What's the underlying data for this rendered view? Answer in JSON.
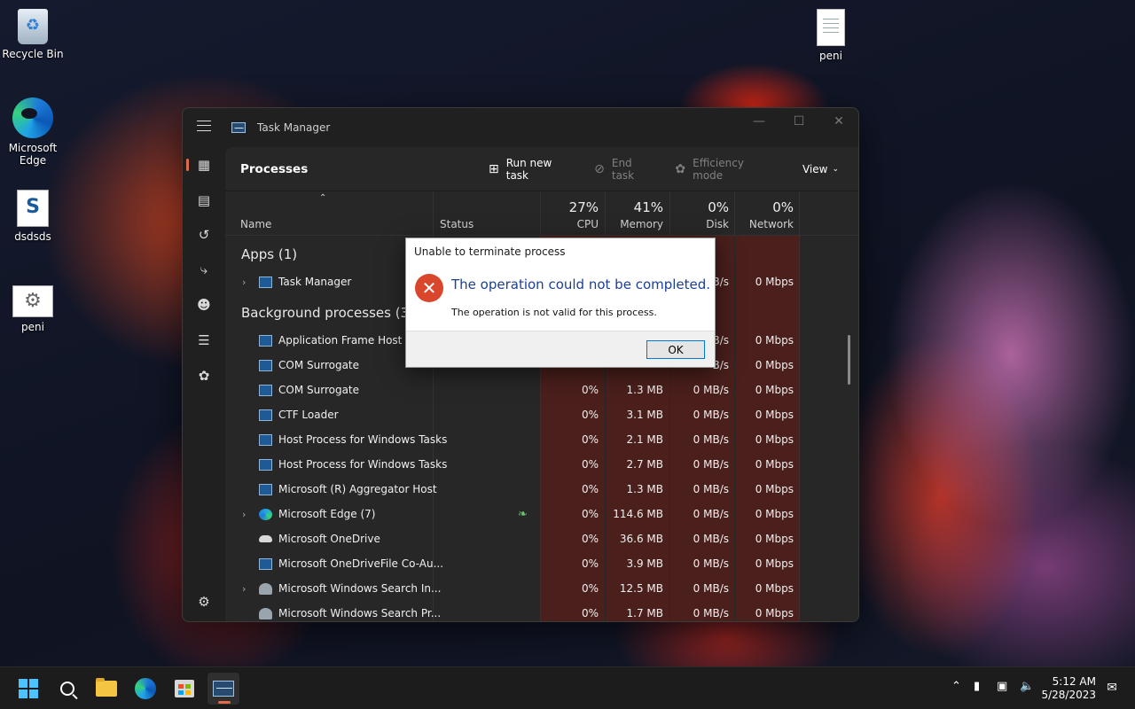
{
  "desktop": {
    "icons": [
      {
        "label": "Recycle Bin"
      },
      {
        "label": "Microsoft Edge"
      },
      {
        "label": "dsdsds"
      },
      {
        "label": "peni"
      },
      {
        "label": "peni"
      }
    ]
  },
  "task_manager": {
    "title": "Task Manager",
    "page_title": "Processes",
    "commands": {
      "run_new_task": "Run new task",
      "end_task": "End task",
      "efficiency_mode": "Efficiency mode",
      "view": "View"
    },
    "columns": {
      "name": "Name",
      "status": "Status",
      "cpu": {
        "label": "CPU",
        "percent": "27%"
      },
      "memory": {
        "label": "Memory",
        "percent": "41%"
      },
      "disk": {
        "label": "Disk",
        "percent": "0%"
      },
      "network": {
        "label": "Network",
        "percent": "0%"
      }
    },
    "groups": {
      "apps": "Apps (1)",
      "background": "Background processes (30)"
    },
    "app_rows": [
      {
        "name": "Task Manager",
        "cpu": "",
        "memory": "",
        "disk": "B/s",
        "network": "0 Mbps"
      }
    ],
    "background_rows": [
      {
        "name": "Application Frame Host",
        "cpu": "",
        "memory": "",
        "disk": "B/s",
        "network": "0 Mbps"
      },
      {
        "name": "COM Surrogate",
        "cpu": "",
        "memory": "",
        "disk": "B/s",
        "network": "0 Mbps"
      },
      {
        "name": "COM Surrogate",
        "cpu": "0%",
        "memory": "1.3 MB",
        "disk": "0 MB/s",
        "network": "0 Mbps"
      },
      {
        "name": "CTF Loader",
        "cpu": "0%",
        "memory": "3.1 MB",
        "disk": "0 MB/s",
        "network": "0 Mbps"
      },
      {
        "name": "Host Process for Windows Tasks",
        "cpu": "0%",
        "memory": "2.1 MB",
        "disk": "0 MB/s",
        "network": "0 Mbps"
      },
      {
        "name": "Host Process for Windows Tasks",
        "cpu": "0%",
        "memory": "2.7 MB",
        "disk": "0 MB/s",
        "network": "0 Mbps"
      },
      {
        "name": "Microsoft (R) Aggregator Host",
        "cpu": "0%",
        "memory": "1.3 MB",
        "disk": "0 MB/s",
        "network": "0 Mbps"
      },
      {
        "name": "Microsoft Edge (7)",
        "cpu": "0%",
        "memory": "114.6 MB",
        "disk": "0 MB/s",
        "network": "0 Mbps"
      },
      {
        "name": "Microsoft OneDrive",
        "cpu": "0%",
        "memory": "36.6 MB",
        "disk": "0 MB/s",
        "network": "0 Mbps"
      },
      {
        "name": "Microsoft OneDriveFile Co-Au...",
        "cpu": "0%",
        "memory": "3.9 MB",
        "disk": "0 MB/s",
        "network": "0 Mbps"
      },
      {
        "name": "Microsoft Windows Search In...",
        "cpu": "0%",
        "memory": "12.5 MB",
        "disk": "0 MB/s",
        "network": "0 Mbps"
      },
      {
        "name": "Microsoft Windows Search Pr...",
        "cpu": "0%",
        "memory": "1.7 MB",
        "disk": "0 MB/s",
        "network": "0 Mbps"
      }
    ]
  },
  "dialog": {
    "title": "Unable to terminate process",
    "main_instruction": "The operation could not be completed.",
    "message": "The operation is not valid for this process.",
    "ok_label": "OK"
  },
  "taskbar": {
    "time": "5:12 AM",
    "date": "5/28/2023"
  },
  "colors": {
    "accent": "#e06a4a",
    "heatmap": "#4a1f1c",
    "error": "#d9462b",
    "dialog_instruction": "#1c3f94"
  }
}
